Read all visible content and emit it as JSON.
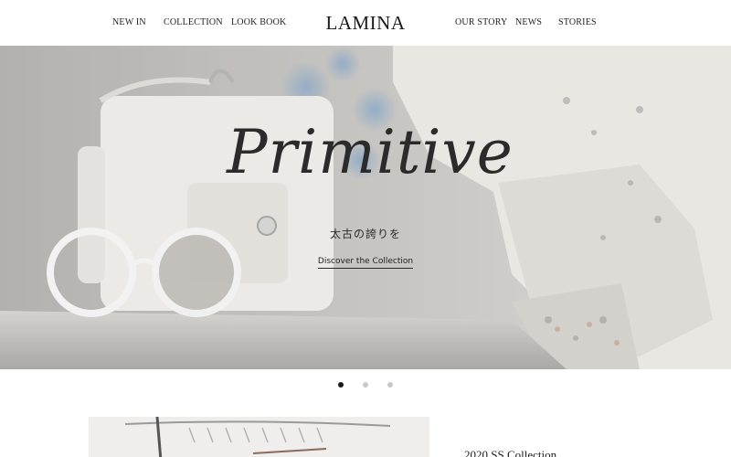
{
  "header": {
    "left_nav": [
      {
        "label": "NEW IN"
      },
      {
        "label": "COLLECTION"
      },
      {
        "label": "LOOK BOOK"
      }
    ],
    "logo": "LAMINA",
    "right_nav": [
      {
        "label": "OUR STORY"
      },
      {
        "label": "NEWS"
      },
      {
        "label": "STORIES"
      }
    ]
  },
  "hero": {
    "title": "Primitive",
    "subtitle": "太古の誇りを",
    "cta": "Discover the Collection",
    "slides_total": 3,
    "active_slide": 1
  },
  "collection": {
    "title": "2020 SS Collection"
  }
}
